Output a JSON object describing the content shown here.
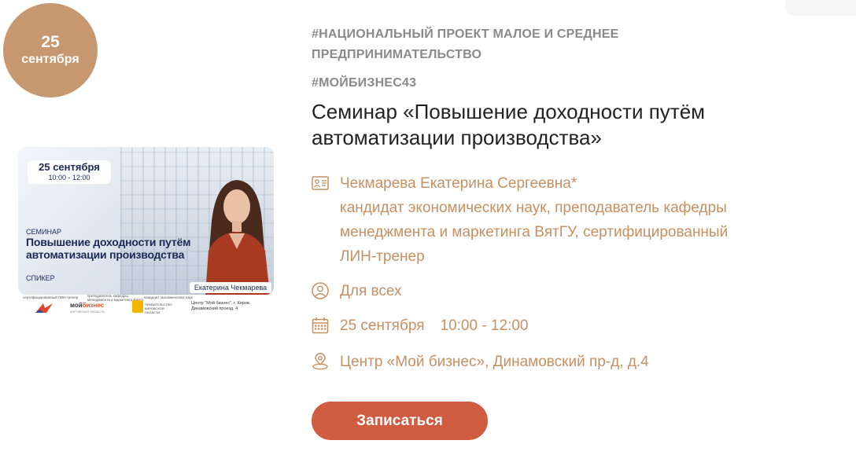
{
  "date_badge": {
    "day": "25",
    "month": "сентября"
  },
  "poster": {
    "date": "25 сентября",
    "time": "10:00 - 12:00",
    "type": "СЕМИНАР",
    "title": "Повышение доходности путём автоматизации производства",
    "speaker_label": "СПИКЕР",
    "speaker_name": "Екатерина Чекмарева",
    "captions": [
      "сертифицированный ЛИН-тренер",
      "преподаватель кафедры менеджмента и маркетинга ВятГУ",
      "кандидат экономических наук"
    ],
    "logo_mybiz": "мой",
    "logo_mybiz_accent": "бизнес",
    "logo_mybiz_sub": "КИРОВСКАЯ ОБЛАСТЬ",
    "logo_gov": "ПРАВИТЕЛЬСТВО КИРОВСКОЙ ОБЛАСТИ",
    "address": "Центр \"Мой бизнес\", г. Киров, Динамовский проезд, 4"
  },
  "tags": [
    "#НАЦИОНАЛЬНЫЙ ПРОЕКТ МАЛОЕ И СРЕДНЕЕ",
    "ПРЕДПРИНИМАТЕЛЬСТВО",
    "#МОЙБИЗНЕС43"
  ],
  "title": "Семинар «Повышение доходности путём автоматизации производства»",
  "speaker": {
    "name": "Чекмарева Екатерина Сергеевна*",
    "desc_lines": [
      "кандидат экономических наук, преподаватель кафедры",
      "менеджмента и маркетинга ВятГУ, сертифицированный",
      "ЛИН-тренер"
    ]
  },
  "audience": "Для всех",
  "date": "25 сентября",
  "time": "10:00 - 12:00",
  "location": "Центр «Мой бизнес», Динамовский пр-д, д.4",
  "register_label": "Записаться",
  "colors": {
    "accent": "#c69063",
    "badge": "#c79870",
    "button": "#cf5b41",
    "title": "#222222",
    "tag": "#8a8a8a"
  }
}
